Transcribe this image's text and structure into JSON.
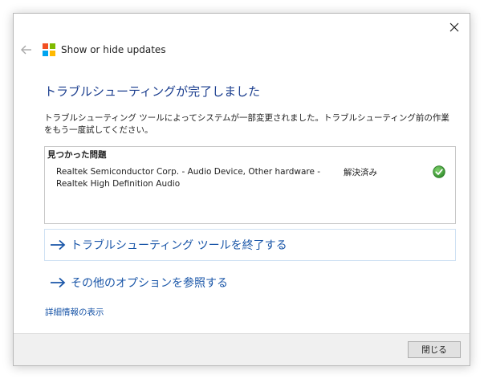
{
  "window": {
    "app_title": "Show or hide updates"
  },
  "main": {
    "heading": "トラブルシューティングが完了しました",
    "description": "トラブルシューティング ツールによってシステムが一部変更されました。トラブルシューティング前の作業をもう一度試してください。",
    "problems": {
      "header": "見つかった問題",
      "items": [
        {
          "text": "Realtek Semiconductor Corp. - Audio Device, Other hardware - Realtek High Definition Audio",
          "status": "解決済み",
          "status_icon": "check-circle-icon"
        }
      ]
    },
    "options": [
      {
        "label": "トラブルシューティング ツールを終了する",
        "icon": "arrow-right-icon"
      },
      {
        "label": "その他のオプションを参照する",
        "icon": "arrow-right-icon"
      }
    ],
    "details_link": "詳細情報の表示"
  },
  "footer": {
    "close_label": "閉じる"
  },
  "colors": {
    "heading": "#1a3d8e",
    "link": "#1a56a8",
    "check_green": "#3d9a36",
    "logo_red": "#f25022",
    "logo_green": "#7fba00",
    "logo_blue": "#00a4ef",
    "logo_yellow": "#ffb900"
  }
}
